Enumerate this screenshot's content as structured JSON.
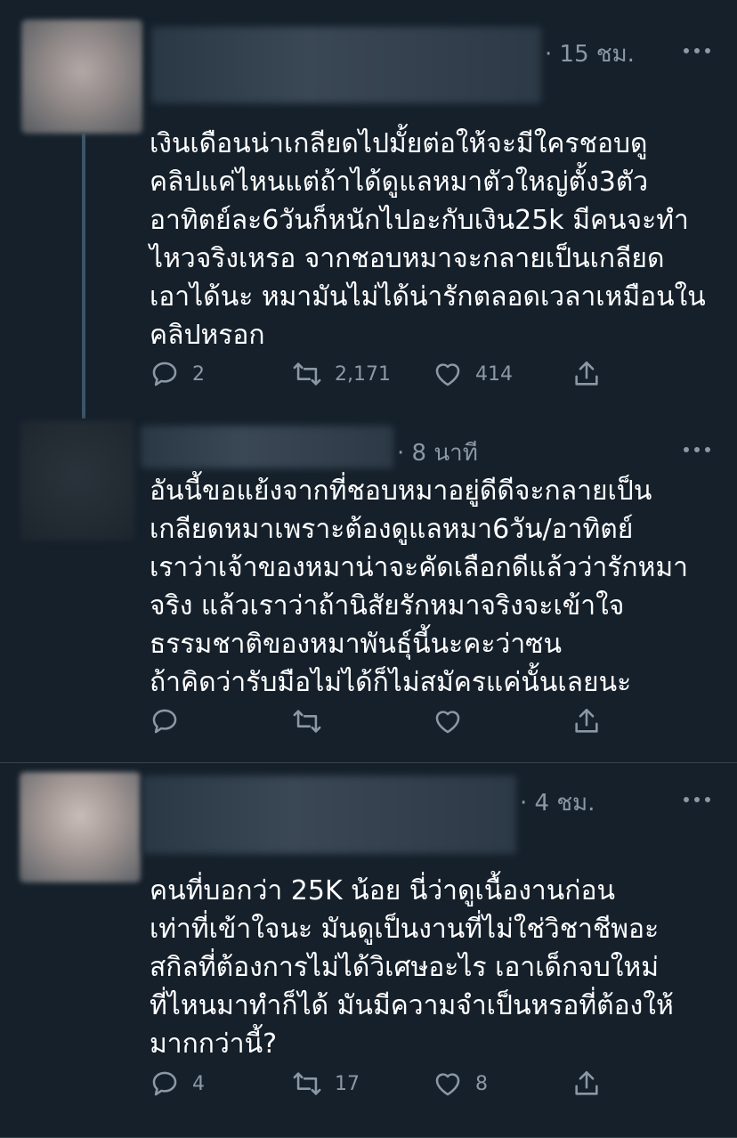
{
  "tweets": [
    {
      "time": "· 15 ชม.",
      "lines": [
        "เงินเดือนน่าเกลียดไปมั้ยต่อให้จะมีใครชอบดู",
        "คลิปแค่ไหนแต่ถ้าได้ดูแลหมาตัวใหญ่ตั้ง3ตัว",
        "อาทิตย์ละ6วันก็หนักไปอะกับเงิน25k มีคนจะทำ",
        "ไหวจริงเหรอ จากชอบหมาจะกลายเป็นเกลียด",
        "เอาได้นะ หมามันไม่ได้น่ารักตลอดเวลาเหมือนใน",
        "คลิปหรอก"
      ],
      "replies": "2",
      "retweets": "2,171",
      "likes": "414"
    },
    {
      "time": "· 8 นาที",
      "lines": [
        "อันนี้ขอแย้งจากที่ชอบหมาอยู่ดีดีจะกลายเป็น",
        "เกลียดหมาเพราะต้องดูแลหมา6วัน/อาทิตย์",
        "เราว่าเจ้าของหมาน่าจะคัดเลือกดีแล้วว่ารักหมา",
        "จริง แล้วเราว่าถ้านิสัยรักหมาจริงจะเข้าใจ",
        "ธรรมชาติของหมาพันธุ์นี้นะคะว่าซน",
        "ถ้าคิดว่ารับมือไม่ได้ก็ไม่สมัครแค่นั้นเลยนะ"
      ],
      "replies": "",
      "retweets": "",
      "likes": ""
    },
    {
      "time": "· 4 ชม.",
      "lines": [
        "คนที่บอกว่า 25K น้อย นี่ว่าดูเนื้องานก่อน",
        "เท่าที่เข้าใจนะ มันดูเป็นงานที่ไม่ใช่วิชาชีพอะ",
        "สกิลที่ต้องการไม่ได้วิเศษอะไร เอาเด็กจบใหม่",
        "ที่ไหนมาทำก็ได้ มันมีความจำเป็นหรอที่ต้องให้",
        "มากกว่านี้?"
      ],
      "replies": "4",
      "retweets": "17",
      "likes": "8"
    }
  ],
  "icons": {
    "reply": "reply-icon",
    "retweet": "retweet-icon",
    "like": "like-icon",
    "share": "share-icon",
    "more": "more-icon"
  },
  "colors": {
    "background": "#15202b",
    "secondary_text": "#8b98a5",
    "divider": "#38444d",
    "thread_line": "#3d5466"
  }
}
